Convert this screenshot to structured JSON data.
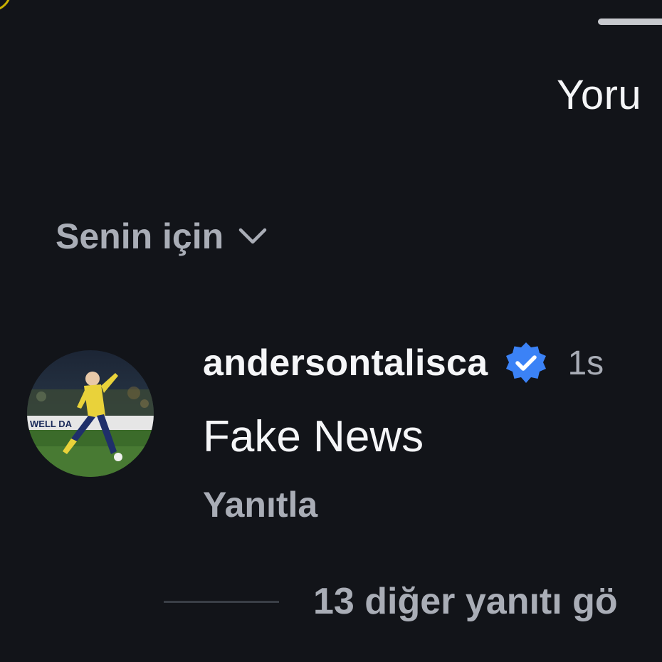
{
  "sheet": {
    "title": "Yoru"
  },
  "sort": {
    "label": "Senin için",
    "icon": "chevron-down-icon"
  },
  "comment": {
    "username": "andersontalisca",
    "verified": true,
    "verified_color": "#3b82f6",
    "timestamp": "1s",
    "text": "Fake News",
    "reply_label": "Yanıtla"
  },
  "replies": {
    "more_label": "13 diğer yanıtı gö"
  },
  "colors": {
    "background": "#121419",
    "text_primary": "#f5f6f8",
    "text_secondary": "#a9adb6",
    "accent": "#c9b000"
  }
}
